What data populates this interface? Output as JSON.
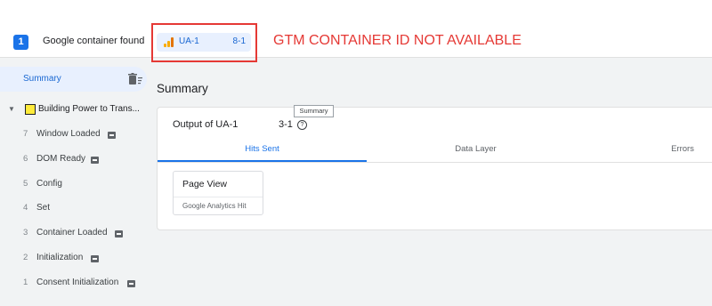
{
  "header": {
    "container_count": "1",
    "container_found_label": "Google container found",
    "container_chip": {
      "name": "UA-1",
      "suffix": "8-1"
    }
  },
  "annotation": {
    "text": "GTM CONTAINER  ID NOT AVAILABLE",
    "color": "#e53935"
  },
  "sidebar": {
    "summary_label": "Summary",
    "page_label": "Building Power to Trans...",
    "events": [
      {
        "num": "7",
        "label": "Window Loaded",
        "icon": "gtm-event-icon"
      },
      {
        "num": "6",
        "label": "DOM Ready",
        "icon": "gtm-event-icon"
      },
      {
        "num": "5",
        "label": "Config",
        "icon": ""
      },
      {
        "num": "4",
        "label": "Set",
        "icon": ""
      },
      {
        "num": "3",
        "label": "Container Loaded",
        "icon": "gtm-event-icon"
      },
      {
        "num": "2",
        "label": "Initialization",
        "icon": "gtm-event-icon"
      },
      {
        "num": "1",
        "label": "Consent Initialization",
        "icon": "gtm-event-icon"
      }
    ]
  },
  "main": {
    "title": "Summary",
    "output_label": "Output of UA-1",
    "output_suffix": "3-1",
    "tooltip": "Summary",
    "tabs": [
      {
        "label": "Hits Sent",
        "active": true
      },
      {
        "label": "Data Layer",
        "active": false
      },
      {
        "label": "Errors",
        "active": false
      }
    ],
    "hit": {
      "title": "Page View",
      "subtitle": "Google Analytics Hit"
    }
  },
  "colors": {
    "accent": "#1a73e8",
    "chip_bg": "#e8f0fe",
    "analytics_orange": "#f9ab00"
  }
}
